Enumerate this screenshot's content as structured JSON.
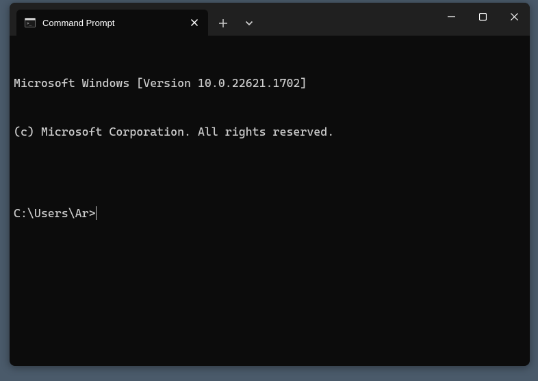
{
  "tab": {
    "title": "Command Prompt"
  },
  "terminal": {
    "line1": "Microsoft Windows [Version 10.0.22621.1702]",
    "line2": "(c) Microsoft Corporation. All rights reserved.",
    "blank": "",
    "prompt": "C:\\Users\\Ar>"
  }
}
